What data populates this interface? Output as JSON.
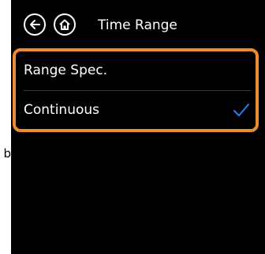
{
  "header": {
    "title": "Time Range",
    "back_icon": "back-arrow-icon",
    "home_icon": "home-icon"
  },
  "options": [
    {
      "label": "Range Spec.",
      "selected": false
    },
    {
      "label": "Continuous",
      "selected": true
    }
  ],
  "stray_text": "b",
  "colors": {
    "screen_background": "#000000",
    "text": "#ffffff",
    "highlight_border": "#ee8a2f",
    "checkmark": "#2f7be8"
  }
}
